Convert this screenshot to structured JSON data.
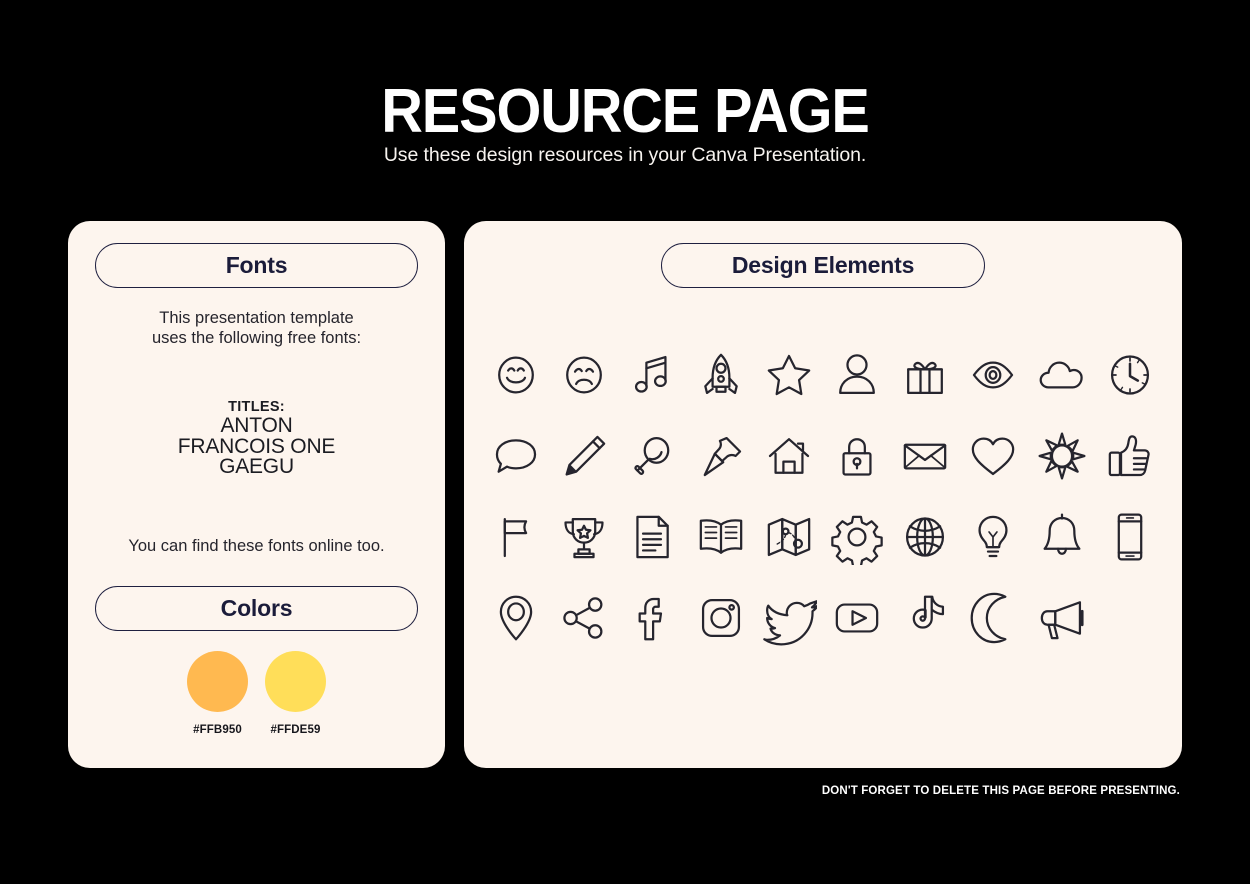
{
  "header": {
    "title": "RESOURCE PAGE",
    "subtitle": "Use these design resources in your Canva Presentation."
  },
  "fonts_card": {
    "heading": "Fonts",
    "intro": "This presentation template\nuses the following free fonts:",
    "titles_label": "TITLES:",
    "titles_list": "ANTON\nFRANCOIS ONE\nGAEGU",
    "outro": "You can find these fonts online too."
  },
  "colors_card": {
    "heading": "Colors",
    "swatches": [
      {
        "hex": "#FFB950",
        "label": "#FFB950"
      },
      {
        "hex": "#FFDE59",
        "label": "#FFDE59"
      }
    ]
  },
  "elements_card": {
    "heading": "Design Elements",
    "icons": [
      "smiley-face-icon",
      "sad-face-icon",
      "music-note-icon",
      "rocket-icon",
      "star-icon",
      "person-icon",
      "gift-icon",
      "eye-icon",
      "cloud-icon",
      "clock-icon",
      "speech-bubble-icon",
      "pencil-icon",
      "magnifier-icon",
      "push-pin-icon",
      "house-icon",
      "lock-icon",
      "envelope-icon",
      "heart-icon",
      "sun-icon",
      "thumbs-up-icon",
      "flag-icon",
      "trophy-icon",
      "document-icon",
      "open-book-icon",
      "map-icon",
      "gear-icon",
      "globe-icon",
      "lightbulb-icon",
      "bell-icon",
      "phone-icon",
      "location-pin-icon",
      "share-icon",
      "facebook-icon",
      "instagram-icon",
      "twitter-icon",
      "youtube-icon",
      "tiktok-icon",
      "moon-icon",
      "megaphone-icon"
    ]
  },
  "footer": {
    "note": "DON'T FORGET TO DELETE THIS PAGE BEFORE PRESENTING."
  },
  "theme": {
    "background": "#000000",
    "card_background": "#FDF5EE",
    "ink": "#1b1c3a",
    "title_color": "#FFFFFF"
  }
}
